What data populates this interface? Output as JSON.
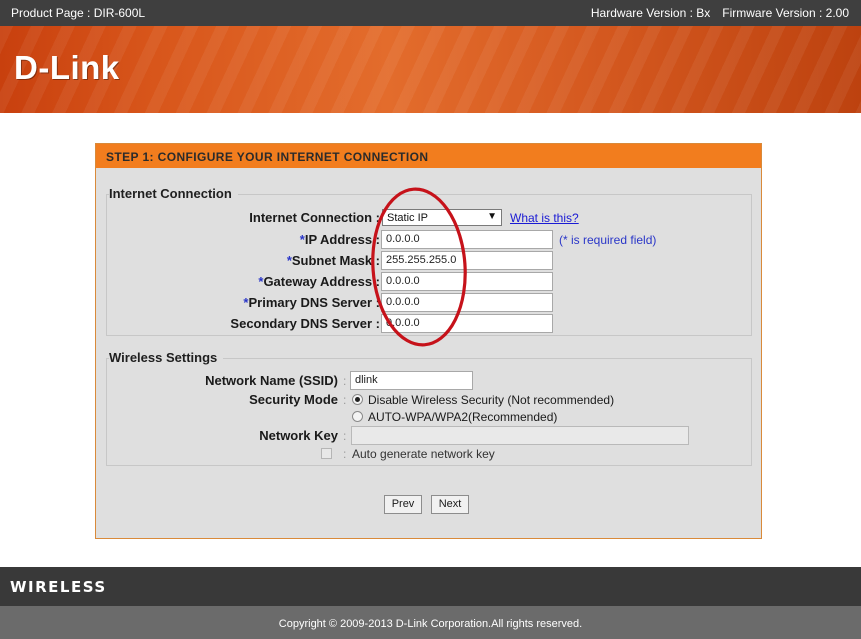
{
  "topbar": {
    "product": "Product Page : DIR-600L",
    "hardware": "Hardware Version : Bx",
    "firmware": "Firmware Version : 2.00"
  },
  "brand": {
    "logo": "D-Link",
    "accent_color": "#f27d1e"
  },
  "wizard": {
    "step_title": "STEP 1: CONFIGURE YOUR INTERNET CONNECTION",
    "internet_section": {
      "title": "Internet Connection",
      "connection_label": "Internet Connection :",
      "connection_value": "Static IP",
      "what_is_this": "What is this?",
      "required_note": "(* is required field)",
      "fields": [
        {
          "required": "*",
          "label": "IP Address :",
          "value": "0.0.0.0"
        },
        {
          "required": "*",
          "label": "Subnet Mask :",
          "value": "255.255.255.0"
        },
        {
          "required": "*",
          "label": "Gateway Address :",
          "value": "0.0.0.0"
        },
        {
          "required": "*",
          "label": "Primary DNS Server :",
          "value": "0.0.0.0"
        },
        {
          "required": "",
          "label": "Secondary DNS Server :",
          "value": "0.0.0.0"
        }
      ]
    },
    "wireless_section": {
      "title": "Wireless Settings",
      "ssid_label": "Network Name (SSID)",
      "ssid_value": "dlink",
      "security_label": "Security Mode",
      "security_options": [
        {
          "label": "Disable Wireless Security (Not recommended)",
          "selected": true
        },
        {
          "label": "AUTO-WPA/WPA2(Recommended)",
          "selected": false
        }
      ],
      "key_label": "Network Key",
      "key_value": "",
      "auto_generate_label": "Auto generate network key",
      "auto_generate_checked": false
    },
    "buttons": {
      "prev": "Prev",
      "next": "Next"
    }
  },
  "wireless_brand": "WIRELESS",
  "footer": {
    "copyright": "Copyright © 2009-2013 D-Link Corporation.All rights reserved."
  }
}
